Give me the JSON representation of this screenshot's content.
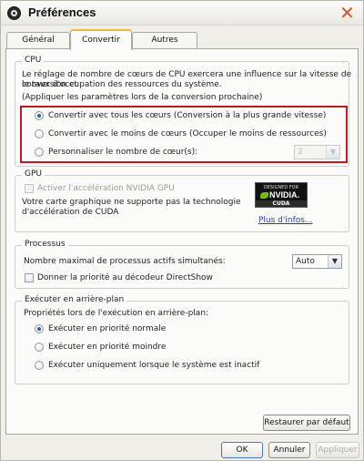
{
  "window": {
    "title": "Préférences",
    "close_glyph": "✕"
  },
  "tabs": [
    "Général",
    "Convertir",
    "Autres"
  ],
  "cpu": {
    "title": "CPU",
    "description_line1": "Le réglage de nombre de cœurs de CPU exercera une influence sur la vitesse de conversion et",
    "description_line2": "le taux d'occupation des ressources du système.",
    "apply_note": "(Appliquer les paramètres lors de la conversion prochaine)",
    "options": [
      {
        "label": "Convertir avec tous les cœurs (Conversion à la plus grande vitesse)",
        "checked": true
      },
      {
        "label": "Convertir avec le moins de cœurs (Occuper le moins de ressources)",
        "checked": false
      },
      {
        "label": "Personnaliser le nombre de cœur(s):",
        "checked": false
      }
    ],
    "core_count_value": "2",
    "highlight_color": "#c0191c"
  },
  "gpu": {
    "title": "GPU",
    "enable_label": "Activer l'accélération NVIDIA GPU",
    "note_line1": "Votre carte graphique ne supporte pas la technologie",
    "note_line2": "d'accélération de CUDA",
    "badge_top": "DESIGNED FOR",
    "badge_name": "NVIDIA.",
    "badge_sub": "CUDA",
    "more_info": "Plus d'infos..."
  },
  "process": {
    "title": "Processus",
    "max_label": "Nombre maximal de processus actifs simultanés:",
    "max_value": "Auto",
    "priority_label": "Donner la priorité au décodeur DirectShow"
  },
  "background": {
    "title": "Exécuter en arrière-plan",
    "props_label": "Propriétés lors de l'exécution en arrière-plan:",
    "options": [
      {
        "label": "Exécuter en priorité normale",
        "checked": true
      },
      {
        "label": "Exécuter en priorité moindre",
        "checked": false
      },
      {
        "label": "Exécuter uniquement lorsque le système est inactif",
        "checked": false
      }
    ]
  },
  "buttons": {
    "restore": "Restaurer par défaut",
    "ok": "OK",
    "cancel": "Annuler",
    "apply": "Appliquer"
  },
  "icons": {
    "app": "film-reel-icon",
    "close": "close-icon",
    "dropdown": "chevron-down-icon"
  }
}
